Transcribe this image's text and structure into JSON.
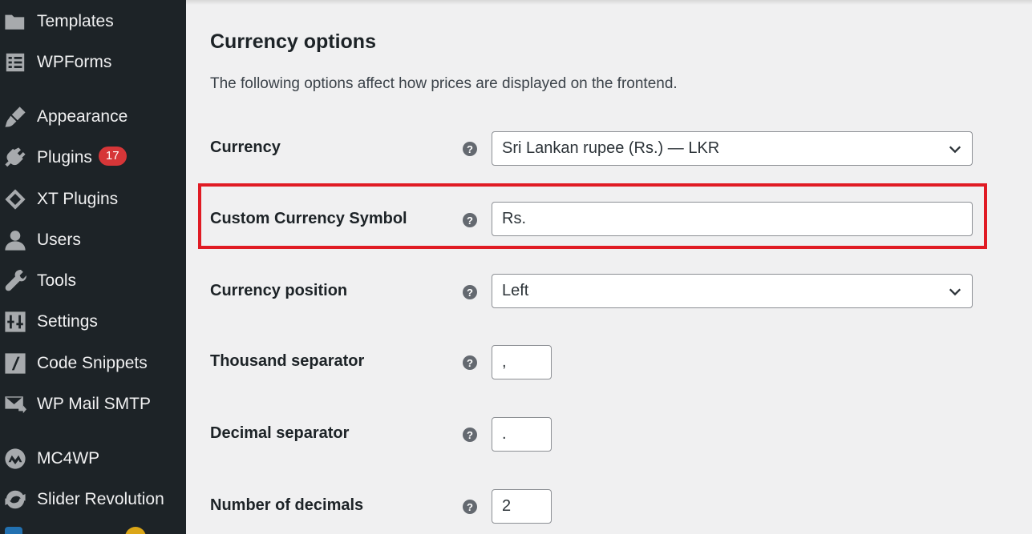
{
  "sidebar": {
    "items": [
      {
        "label": "Templates",
        "icon": "folder-icon"
      },
      {
        "label": "WPForms",
        "icon": "wpforms-icon"
      },
      {
        "label": "Appearance",
        "icon": "brush-icon"
      },
      {
        "label": "Plugins",
        "icon": "plug-icon",
        "badge": "17"
      },
      {
        "label": "XT Plugins",
        "icon": "xt-icon"
      },
      {
        "label": "Users",
        "icon": "user-icon"
      },
      {
        "label": "Tools",
        "icon": "wrench-icon"
      },
      {
        "label": "Settings",
        "icon": "settings-icon"
      },
      {
        "label": "Code Snippets",
        "icon": "code-icon"
      },
      {
        "label": "WP Mail SMTP",
        "icon": "mail-icon"
      },
      {
        "label": "MC4WP",
        "icon": "mc4wp-icon"
      },
      {
        "label": "Slider Revolution",
        "icon": "refresh-icon"
      }
    ]
  },
  "section": {
    "title": "Currency options",
    "description": "The following options affect how prices are displayed on the frontend."
  },
  "fields": {
    "currency": {
      "label": "Currency",
      "value": "Sri Lankan rupee (Rs.) — LKR"
    },
    "custom_symbol": {
      "label": "Custom Currency Symbol",
      "value": "Rs."
    },
    "position": {
      "label": "Currency position",
      "value": "Left"
    },
    "thousand": {
      "label": "Thousand separator",
      "value": ","
    },
    "decimal": {
      "label": "Decimal separator",
      "value": "."
    },
    "decimals": {
      "label": "Number of decimals",
      "value": "2"
    }
  },
  "help_glyph": "?",
  "colors": {
    "sidebar_bg": "#1d2327",
    "badge": "#d63638",
    "highlight": "#e01b24"
  }
}
